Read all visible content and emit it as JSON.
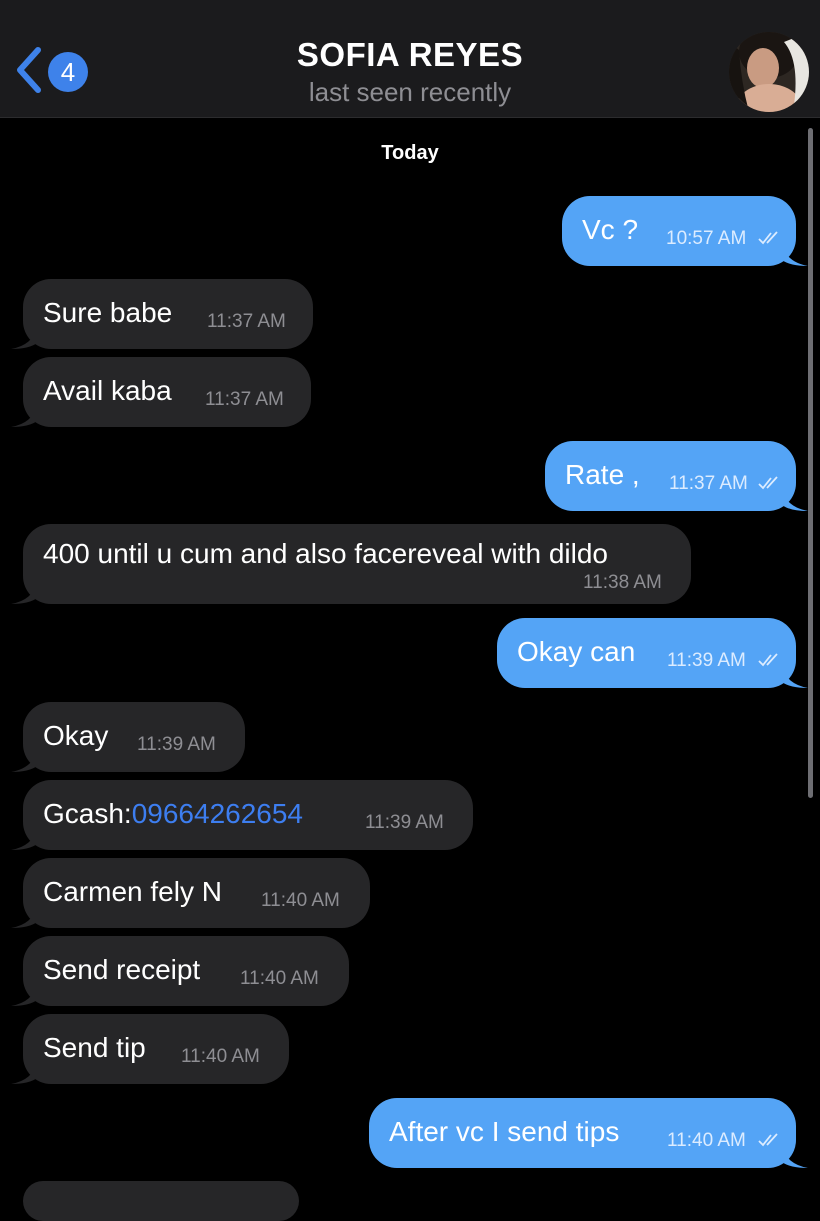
{
  "header": {
    "back_count": "4",
    "contact_name": "SOFIA REYES",
    "status": "last seen recently"
  },
  "chat": {
    "date_label": "Today",
    "messages": [
      {
        "dir": "out",
        "text": "Vc ?",
        "time": "10:57 AM",
        "read": true
      },
      {
        "dir": "in",
        "text": "Sure babe",
        "time": "11:37 AM"
      },
      {
        "dir": "in",
        "text": "Avail kaba",
        "time": "11:37 AM"
      },
      {
        "dir": "out",
        "text": "Rate ,",
        "time": "11:37 AM",
        "read": true
      },
      {
        "dir": "in",
        "text": "400 until u cum and also facereveal with dildo",
        "time": "11:38 AM"
      },
      {
        "dir": "out",
        "text": "Okay can",
        "time": "11:39 AM",
        "read": true
      },
      {
        "dir": "in",
        "text": "Okay",
        "time": "11:39 AM"
      },
      {
        "dir": "in",
        "text_prefix": "Gcash:",
        "text_link": "09664262654",
        "time": "11:39 AM"
      },
      {
        "dir": "in",
        "text": "Carmen fely N",
        "time": "11:40 AM"
      },
      {
        "dir": "in",
        "text": "Send receipt",
        "time": "11:40 AM"
      },
      {
        "dir": "in",
        "text": "Send tip",
        "time": "11:40 AM"
      },
      {
        "dir": "out",
        "text": "After vc I send tips",
        "time": "11:40 AM",
        "read": true
      }
    ]
  },
  "colors": {
    "incoming_bubble": "#262628",
    "outgoing_bubble": "#54a4f6",
    "accent": "#3e82ea",
    "link": "#3d7ef0"
  }
}
